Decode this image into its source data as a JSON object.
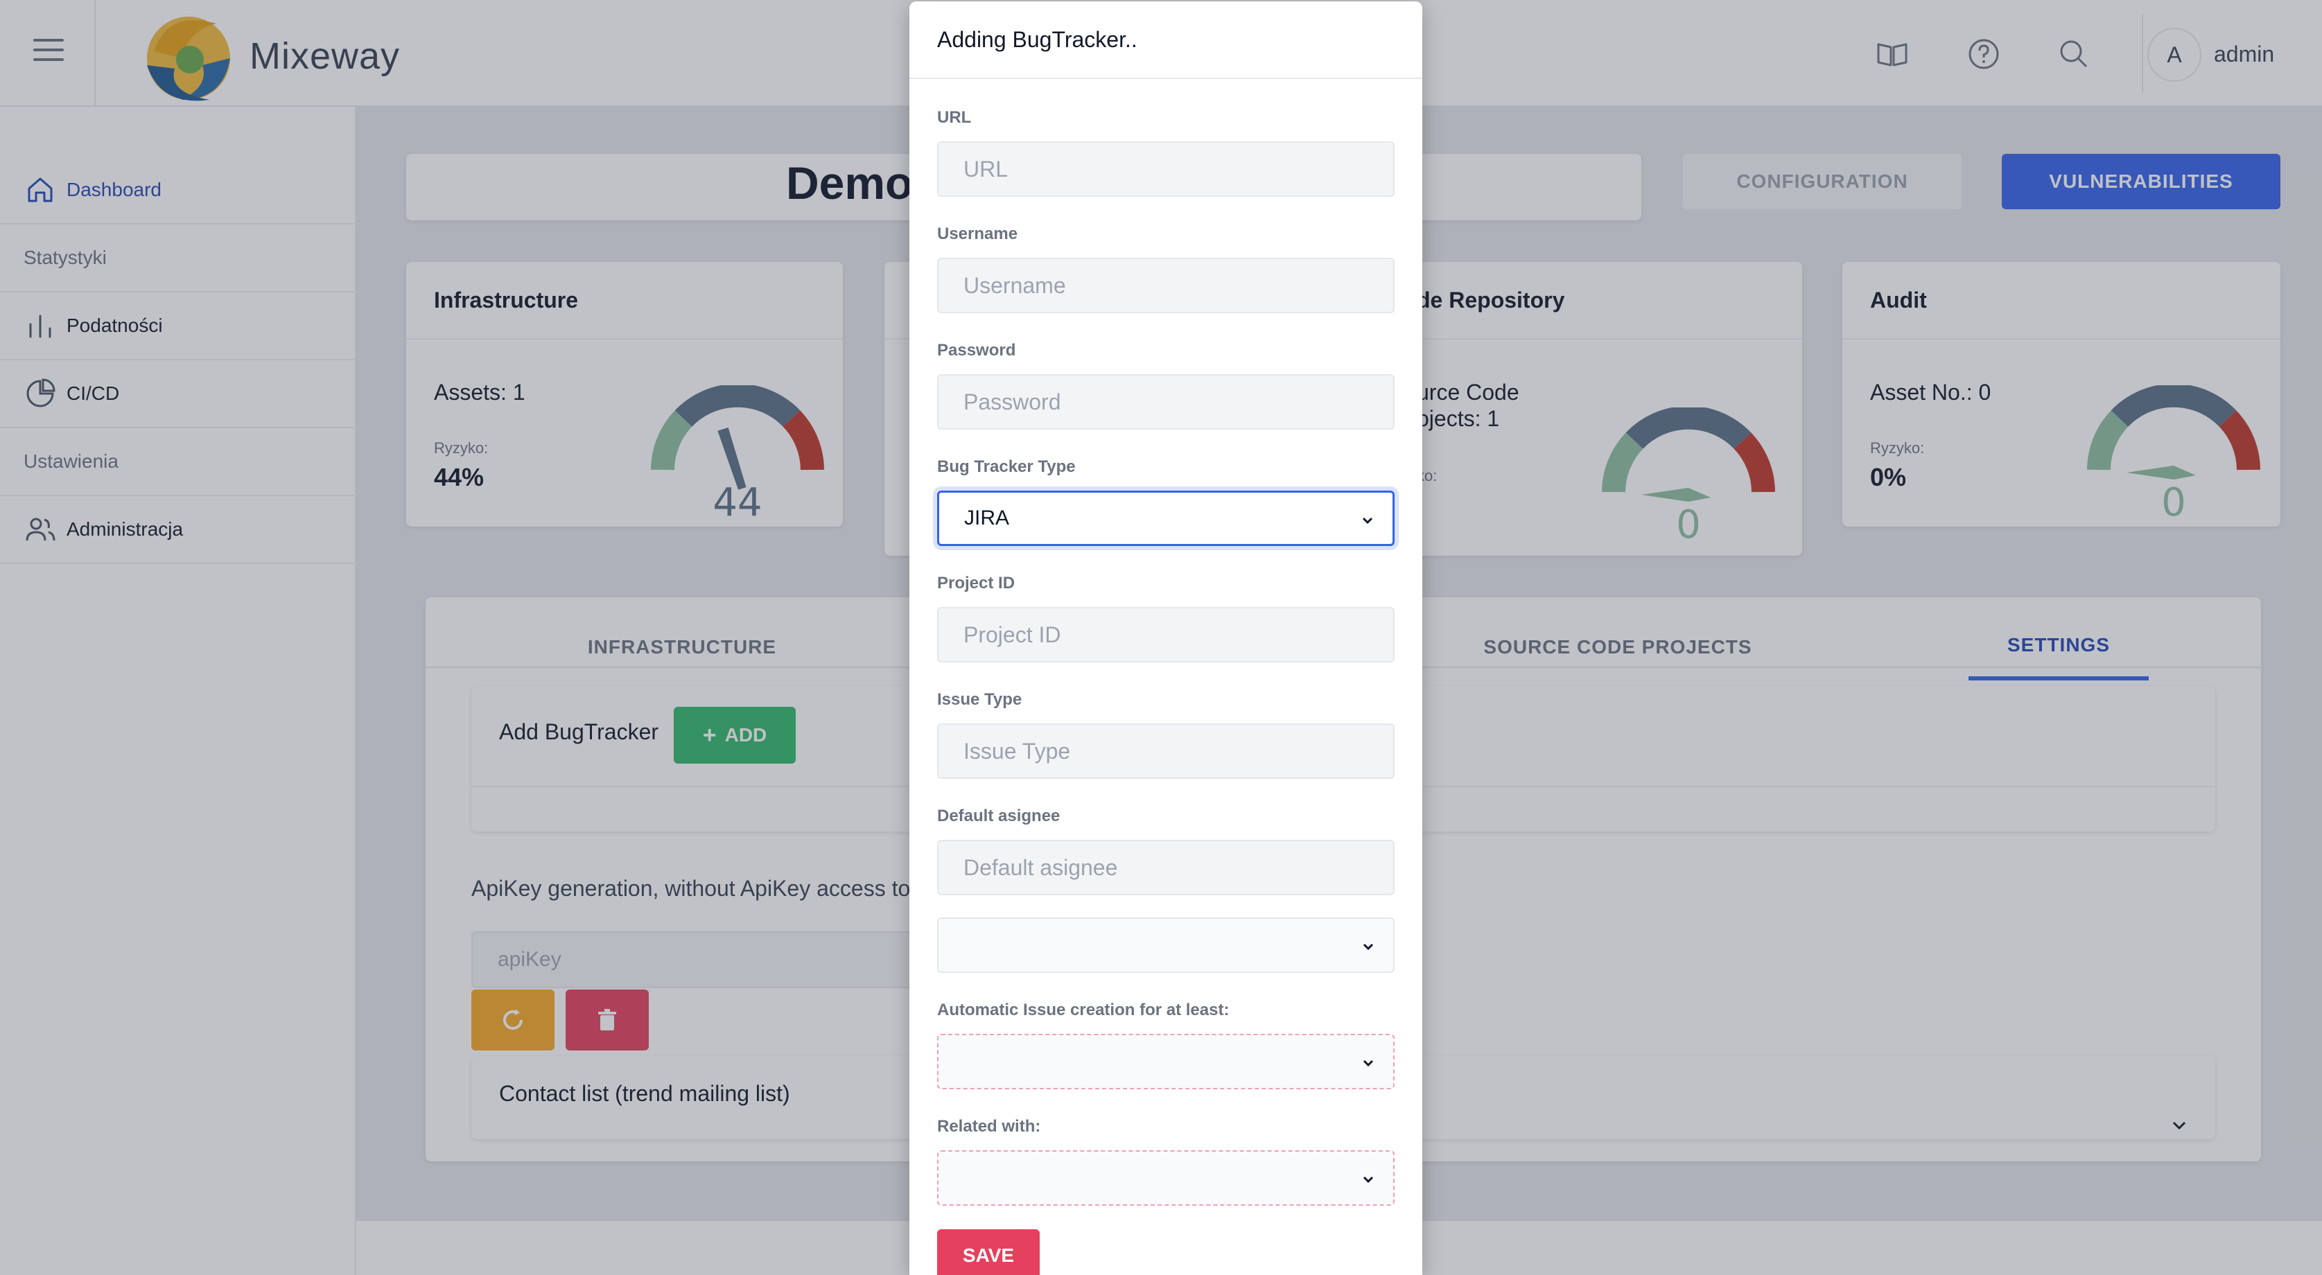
{
  "app": {
    "brand": "Mixeway",
    "user_initial": "A",
    "user_name": "admin"
  },
  "sidebar": {
    "items": [
      {
        "label": "Dashboard",
        "icon": "home-icon",
        "active": true
      },
      {
        "section": "Statystyki"
      },
      {
        "label": "Podatności",
        "icon": "bar-chart-icon"
      },
      {
        "label": "CI/CD",
        "icon": "pie-chart-icon"
      },
      {
        "section": "Ustawienia"
      },
      {
        "label": "Administracja",
        "icon": "users-icon"
      }
    ]
  },
  "project": {
    "title": "Demo",
    "configuration_label": "CONFIGURATION",
    "vulnerabilities_label": "VULNERABILITIES"
  },
  "cards": [
    {
      "title": "Infrastructure",
      "line1": "Assets: 1",
      "risk_label": "Ryzyko:",
      "risk_value": "44%",
      "gauge_value": "44"
    },
    {
      "title": "de Repository",
      "line1": "urce Code",
      "line2": "ojects: 1",
      "risk_label": "ko:",
      "risk_value": "",
      "gauge_value": "0"
    },
    {
      "title": "Audit",
      "line1": "Asset No.: 0",
      "risk_label": "Ryzyko:",
      "risk_value": "0%",
      "gauge_value": "0"
    }
  ],
  "tabs": {
    "infrastructure": "INFRASTRUCTURE",
    "source_code": "SOURCE CODE PROJECTS",
    "settings": "SETTINGS"
  },
  "settings": {
    "add_bugtracker_label": "Add BugTracker",
    "add_button": "ADD",
    "apikey_text": "ApiKey generation, without ApiKey access to A",
    "apikey_placeholder": "apiKey",
    "contact_list_label": "Contact list (trend mailing list)"
  },
  "modal": {
    "title": "Adding BugTracker..",
    "fields": {
      "url": {
        "label": "URL",
        "placeholder": "URL"
      },
      "username": {
        "label": "Username",
        "placeholder": "Username"
      },
      "password": {
        "label": "Password",
        "placeholder": "Password"
      },
      "bug_tracker_type": {
        "label": "Bug Tracker Type",
        "value": "JIRA"
      },
      "project_id": {
        "label": "Project ID",
        "placeholder": "Project ID"
      },
      "issue_type": {
        "label": "Issue Type",
        "placeholder": "Issue Type"
      },
      "default_asignee": {
        "label": "Default asignee",
        "placeholder": "Default asignee"
      },
      "unnamed_select": {
        "value": ""
      },
      "automatic_issue": {
        "label": "Automatic Issue creation for at least:",
        "value": ""
      },
      "related_with": {
        "label": "Related with:",
        "value": ""
      }
    },
    "save_label": "SAVE"
  },
  "colors": {
    "primary": "#3563e9",
    "success": "#33b86b",
    "warning": "#f6a928",
    "danger": "#e5415e",
    "gauge_low": "#8fbf9f",
    "gauge_mid": "#5a6f86",
    "gauge_high": "#c0392b"
  }
}
